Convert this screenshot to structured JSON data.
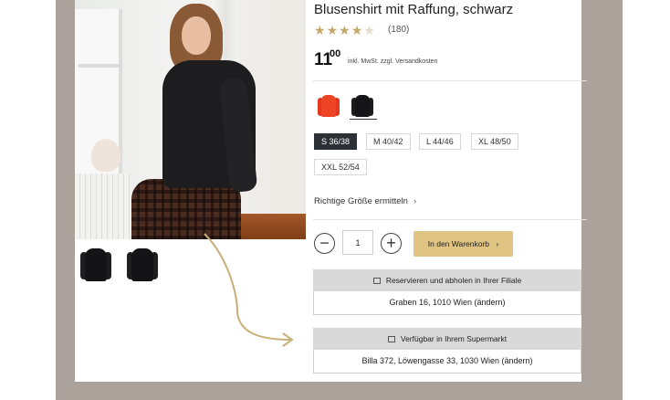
{
  "product": {
    "title": "Blusenshirt mit Raffung, schwarz",
    "rating_stars": 4,
    "rating_max": 5,
    "review_count": "(180)",
    "price_integer": "11",
    "price_decimal": "00",
    "price_note": "inkl. MwSt. zzgl. Versandkosten"
  },
  "colors": [
    {
      "name": "rot",
      "hex": "#e5391f",
      "selected": false
    },
    {
      "name": "schwarz",
      "hex": "#151517",
      "selected": true
    }
  ],
  "sizes": [
    {
      "label": "S 36/38",
      "active": true
    },
    {
      "label": "M 40/42",
      "active": false
    },
    {
      "label": "L 44/46",
      "active": false
    },
    {
      "label": "XL 48/50",
      "active": false
    },
    {
      "label": "XXL 52/54",
      "active": false
    }
  ],
  "size_help": "Richtige Größe ermitteln",
  "quantity": "1",
  "cart_button": "In den Warenkorb",
  "store": {
    "header": "Reservieren und abholen in Ihrer Filiale",
    "address": "Graben 16, 1010 Wien (ändern)"
  },
  "supermarket": {
    "header": "Verfügbar in Ihrem Supermarkt",
    "address": "Billa 372, Löwengasse 33, 1030 Wien (ändern)"
  },
  "icons": {
    "minus": "−",
    "plus": "+",
    "chevron": "›",
    "cart_chevron": "›"
  },
  "theme": {
    "accent": "#e0c484",
    "star_on": "#c4a867",
    "arrow": "#c8b07b",
    "frame": "#aba29b"
  }
}
